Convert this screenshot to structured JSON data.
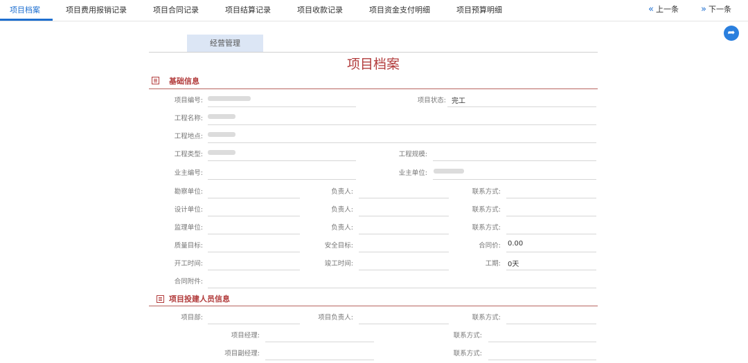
{
  "tabs": [
    {
      "label": "项目档案",
      "active": true
    },
    {
      "label": "项目费用报销记录"
    },
    {
      "label": "项目合同记录"
    },
    {
      "label": "项目结算记录"
    },
    {
      "label": "项目收款记录"
    },
    {
      "label": "项目资金支付明细"
    },
    {
      "label": "项目预算明细"
    }
  ],
  "nav": {
    "prev": "上一条",
    "next": "下一条"
  },
  "subtab": "经营管理",
  "title": "项目档案",
  "section1": {
    "title": "基础信息",
    "labels": {
      "project_no": "项目编号:",
      "project_status": "项目状态:",
      "project_name": "工程名称:",
      "location": "工程地点:",
      "project_type": "工程类型:",
      "scale": "工程规模:",
      "owner_no": "业主编号:",
      "owner_unit": "业主单位:",
      "survey_unit": "勘察单位:",
      "design_unit": "设计单位:",
      "supervision_unit": "监理单位:",
      "person_in_charge": "负责人:",
      "contact": "联系方式:",
      "quality_goal": "质量目标:",
      "safety_goal": "安全目标:",
      "contract_price": "合同价:",
      "start_time": "开工时间:",
      "finish_time": "竣工时间:",
      "duration": "工期:",
      "attachment": "合同附件:"
    },
    "values": {
      "project_status": "完工",
      "contract_price": "0.00",
      "duration": "0天"
    }
  },
  "section2": {
    "title": "项目投建人员信息",
    "labels": {
      "dept": "项目部:",
      "project_leader": "项目负责人:",
      "contact": "联系方式:",
      "manager": "项目经理:",
      "deputy_manager": "项目副经理:"
    }
  },
  "colors": {
    "accent": "#1e6fd0",
    "section": "#b23b3b"
  }
}
